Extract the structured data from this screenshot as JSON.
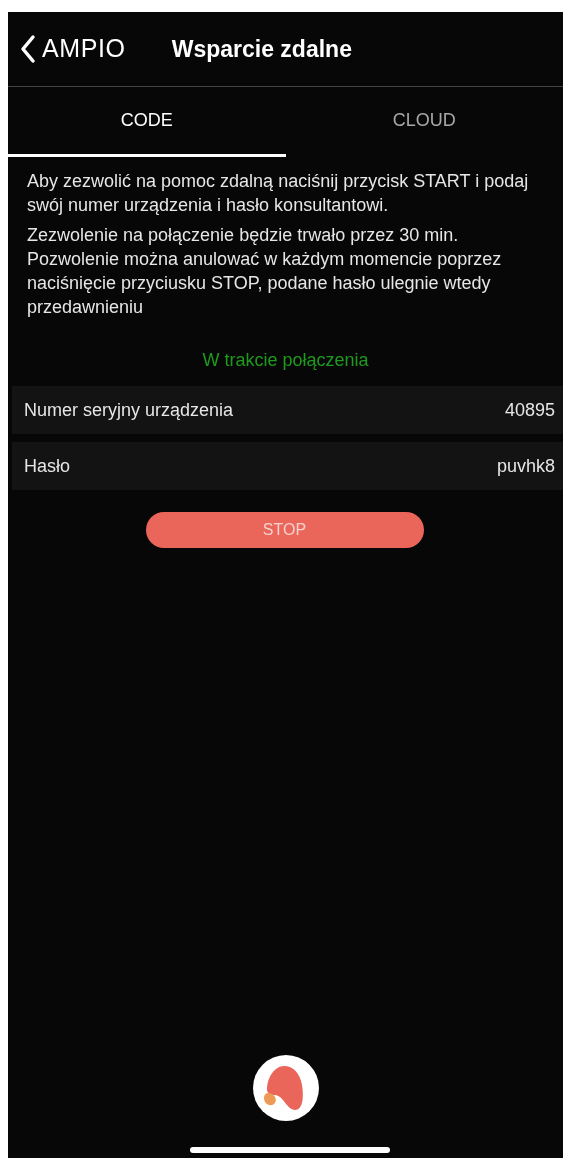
{
  "header": {
    "back_label": "AMPIO",
    "title": "Wsparcie zdalne"
  },
  "tabs": [
    {
      "label": "CODE",
      "selected": true
    },
    {
      "label": "CLOUD",
      "selected": false
    }
  ],
  "paragraphs": [
    "Aby zezwolić na pomoc zdalną naciśnij przycisk START i podaj swój numer urządzenia i hasło konsultantowi.",
    "Zezwolenie na połączenie będzie trwało przez 30 min. Pozwolenie można anulować w każdym momencie poprzez naciśnięcie przyciusku STOP, podane hasło ulegnie wtedy przedawnieniu"
  ],
  "status": "W trakcie połączenia",
  "fields": [
    {
      "label": "Numer seryjny urządzenia",
      "value": "40895"
    },
    {
      "label": "Hasło",
      "value": "puvhk8"
    }
  ],
  "button": "STOP"
}
